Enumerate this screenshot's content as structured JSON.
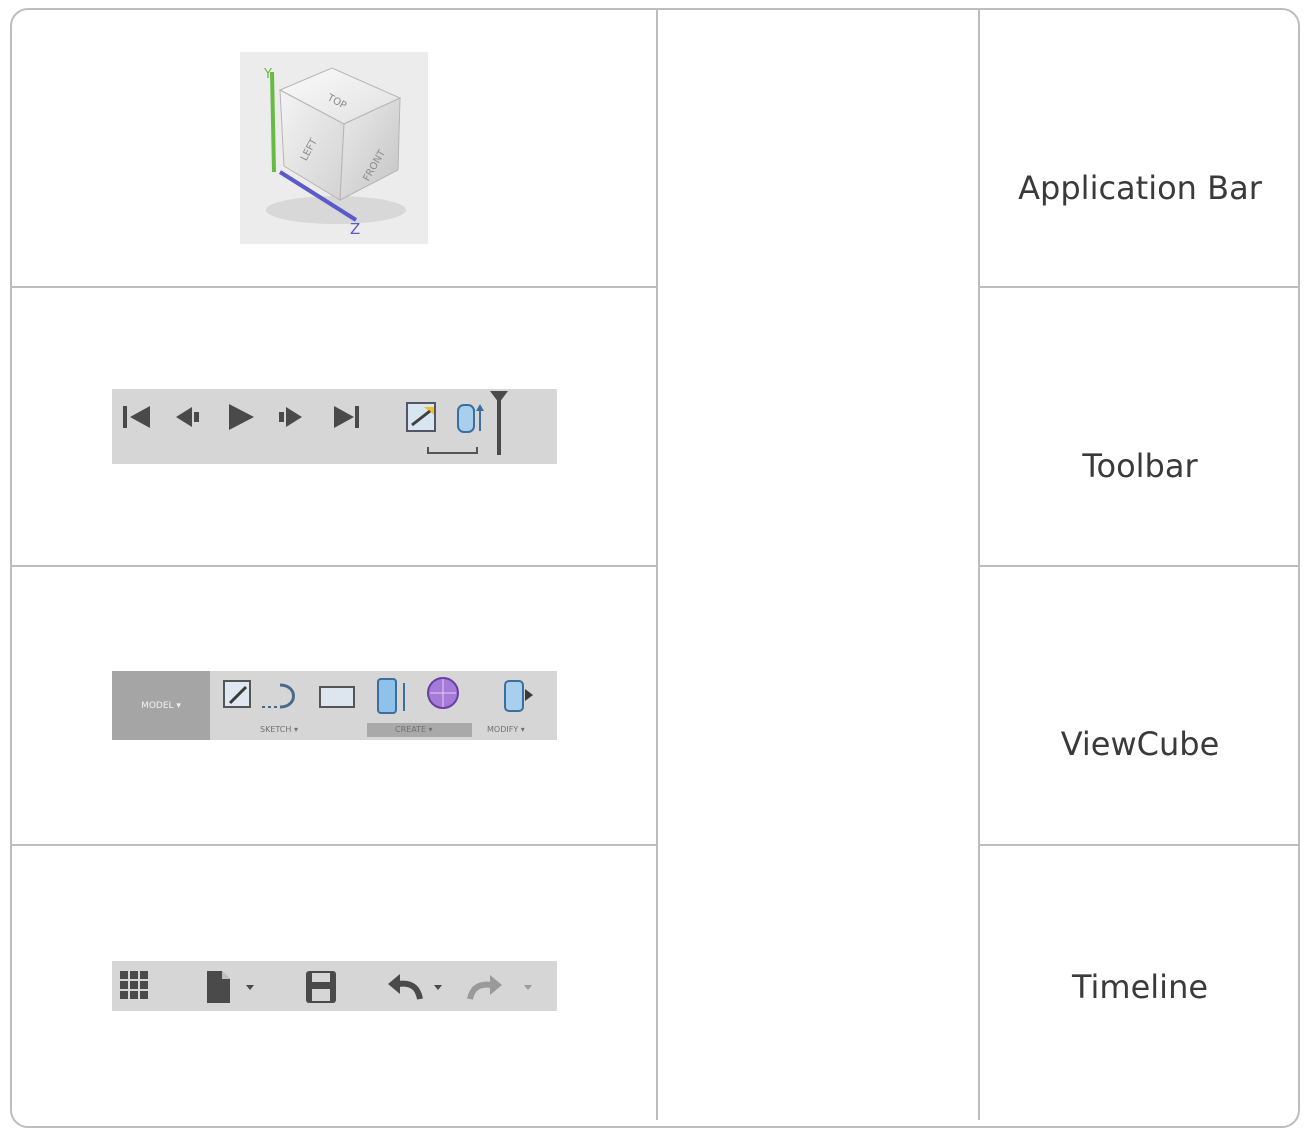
{
  "labels": {
    "application_bar": "Application Bar",
    "toolbar": "Toolbar",
    "viewcube": "ViewCube",
    "timeline": "Timeline"
  },
  "viewcube": {
    "top": "TOP",
    "left": "LEFT",
    "front": "FRONT",
    "axis_y": "Y",
    "axis_z": "Z"
  },
  "toolbar": {
    "model_label": "MODEL",
    "sketch_label": "SKETCH",
    "create_label": "CREATE",
    "modify_label": "MODIFY"
  },
  "icons": {
    "timeline": [
      "skip-to-start-icon",
      "step-back-icon",
      "play-icon",
      "step-forward-icon",
      "skip-to-end-icon",
      "sketch-feature-icon",
      "extrude-feature-icon",
      "timeline-marker-icon"
    ],
    "toolbar": [
      "create-sketch-icon",
      "revolve-icon",
      "rectangle-icon",
      "extrude-icon",
      "sphere-icon",
      "press-pull-icon"
    ],
    "appbar": [
      "data-panel-grid-icon",
      "file-icon",
      "save-icon",
      "undo-icon",
      "redo-icon"
    ]
  },
  "colors": {
    "axis_y": "#66bb44",
    "axis_z": "#5a5ac8",
    "grid_line": "#bdbdbd",
    "bar_gray": "#d6d6d6",
    "icon_dark": "#505050"
  }
}
